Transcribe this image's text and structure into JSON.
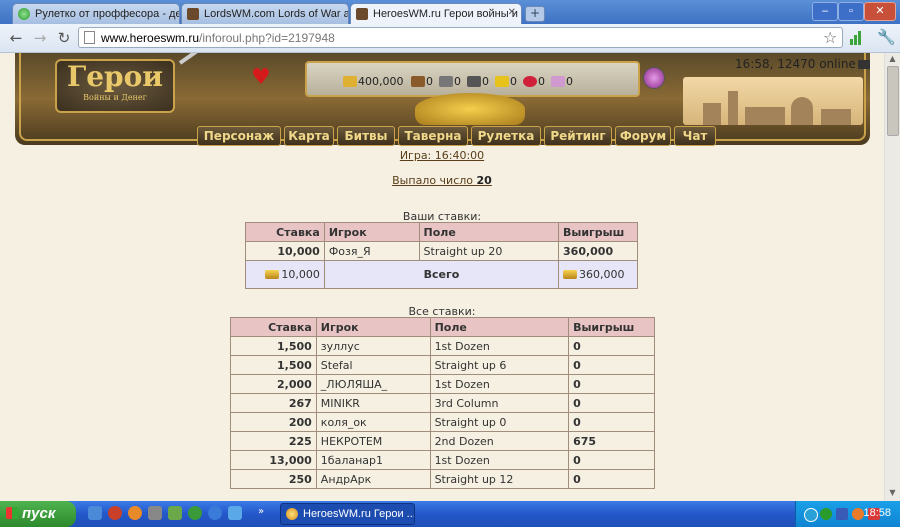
{
  "browser": {
    "tabs": [
      {
        "title": "Рулетко от проффесора - де",
        "icon": "green-circle"
      },
      {
        "title": "LordsWM.com Lords of War ar",
        "icon": "helmet"
      },
      {
        "title": "HeroesWM.ru Герои войны и",
        "icon": "helmet"
      }
    ],
    "new_tab": "+",
    "window_buttons": [
      "–",
      "▫",
      "✕"
    ],
    "url_host": "www.heroeswm.ru",
    "url_path": "/inforoul.php?id=2197948"
  },
  "header": {
    "logo_title": "Герои",
    "logo_subtitle": "Войны и Денег",
    "server_time": "16:58, 12470 online",
    "resources": [
      {
        "name": "gold",
        "value": "400,000",
        "color": "#e0b030"
      },
      {
        "name": "wood",
        "value": "0",
        "color": "#8a5a2a"
      },
      {
        "name": "ore",
        "value": "0",
        "color": "#777777"
      },
      {
        "name": "mercury",
        "value": "0",
        "color": "#555555"
      },
      {
        "name": "sulfur",
        "value": "0",
        "color": "#e6c21a"
      },
      {
        "name": "crystals",
        "value": "0",
        "color": "#d0203a"
      },
      {
        "name": "gems",
        "value": "0",
        "color": "#d09ad0"
      }
    ],
    "menu": [
      "Персонаж",
      "Карта",
      "Битвы",
      "Таверна",
      "Рулетка",
      "Рейтинг",
      "Форум",
      "Чат"
    ]
  },
  "game_link": "Игра: 16:40:00",
  "result_text": "Выпало число",
  "result_number": "20",
  "your_bets": {
    "caption": "Ваши ставки:",
    "headers": [
      "Ставка",
      "Игрок",
      "Поле",
      "Выигрыш"
    ],
    "rows": [
      {
        "stake": "10,000",
        "player": "Фозя_Я",
        "field": "Straight up 20",
        "win": "360,000"
      }
    ],
    "total_label": "Всего",
    "total_stake": "10,000",
    "total_win": "360,000"
  },
  "all_bets": {
    "caption": "Все ставки:",
    "headers": [
      "Ставка",
      "Игрок",
      "Поле",
      "Выигрыш"
    ],
    "rows": [
      {
        "stake": "1,500",
        "player": "зуллус",
        "field": "1st Dozen",
        "win": "0"
      },
      {
        "stake": "1,500",
        "player": "Stefal",
        "field": "Straight up 6",
        "win": "0"
      },
      {
        "stake": "2,000",
        "player": "_ЛЮЛЯША_",
        "field": "1st Dozen",
        "win": "0"
      },
      {
        "stake": "267",
        "player": "MINIKR",
        "field": "3rd Column",
        "win": "0"
      },
      {
        "stake": "200",
        "player": "коля_ок",
        "field": "Straight up 0",
        "win": "0"
      },
      {
        "stake": "225",
        "player": "НЕКРОТЕМ",
        "field": "2nd Dozen",
        "win": "675"
      },
      {
        "stake": "13,000",
        "player": "1баланар1",
        "field": "1st Dozen",
        "win": "0"
      },
      {
        "stake": "250",
        "player": "АндрАрк",
        "field": "Straight up 12",
        "win": "0"
      }
    ]
  },
  "taskbar": {
    "start": "пуск",
    "window_title": "HeroesWM.ru Герои ...",
    "clock": "18:58"
  }
}
